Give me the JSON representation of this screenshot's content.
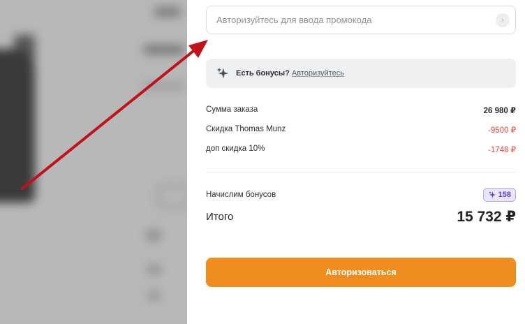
{
  "promo": {
    "placeholder": "Авторизуйтесь для ввода промокода",
    "submit_icon": "chevron-right-icon"
  },
  "bonus": {
    "question": "Есть бонусы?",
    "link": "Авторизуйтесь",
    "icon": "sparkle-icon"
  },
  "summary": [
    {
      "label": "Сумма заказа",
      "value": "26 980 ₽",
      "type": "total"
    },
    {
      "label": "Скидка Thomas Munz",
      "value": "-9500 ₽",
      "type": "discount"
    },
    {
      "label": "доп скидка 10%",
      "value": "-1748 ₽",
      "type": "discount"
    }
  ],
  "accrual": {
    "label": "Начислим бонусов",
    "amount": "158"
  },
  "total": {
    "label": "Итого",
    "value": "15 732 ₽"
  },
  "auth_button": {
    "label": "Авторизоваться"
  },
  "colors": {
    "accent": "#f08d1f",
    "discount": "#e8453c",
    "bonus_chip": "#ece6fd",
    "arrow": "#c0121b"
  }
}
